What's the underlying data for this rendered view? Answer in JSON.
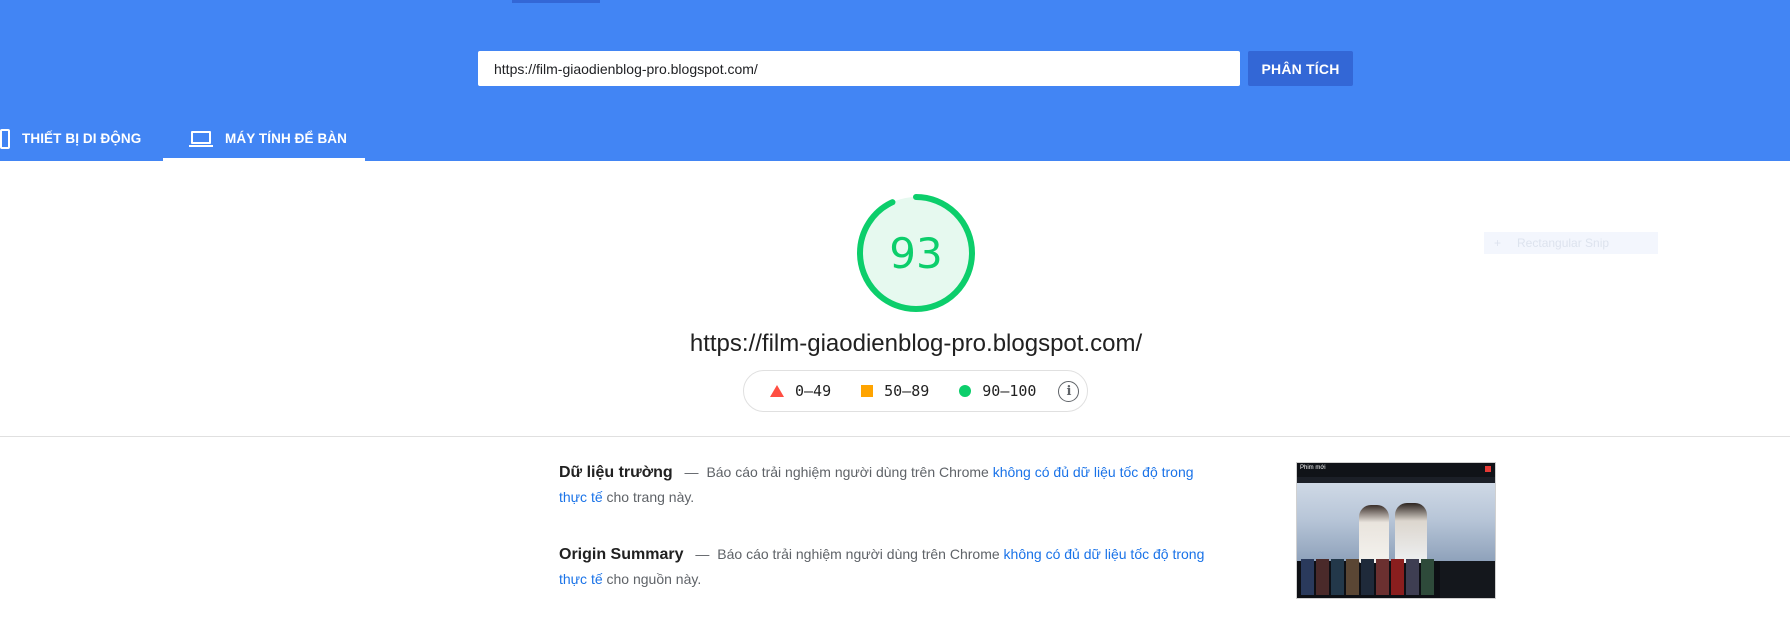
{
  "header": {
    "url_value": "https://film-giaodienblog-pro.blogspot.com/",
    "analyze_label": "PHÂN TÍCH",
    "tabs": [
      {
        "label": "THIẾT BỊ DI ĐỘNG",
        "icon": "phone-icon",
        "active": false
      },
      {
        "label": "MÁY TÍNH ĐỂ BÀN",
        "icon": "laptop-icon",
        "active": true
      }
    ],
    "colors": {
      "background": "#4285f4",
      "button": "#3367d6"
    }
  },
  "score": {
    "value": "93",
    "fraction": 0.93,
    "color": "#0cce6b",
    "analyzed_url": "https://film-giaodienblog-pro.blogspot.com/"
  },
  "legend": {
    "items": [
      {
        "range": "0–49",
        "shape": "triangle",
        "color": "#ff4e42"
      },
      {
        "range": "50–89",
        "shape": "square",
        "color": "#ffa400"
      },
      {
        "range": "90–100",
        "shape": "circle",
        "color": "#0cce6b"
      }
    ],
    "info_icon": "info-icon"
  },
  "overlay": {
    "snip_label": "Rectangular Snip"
  },
  "field_data": {
    "title": "Dữ liệu trường",
    "dash": "—",
    "text_before": "Báo cáo trải nghiệm người dùng trên Chrome ",
    "link_text": "không có đủ dữ liệu tốc độ trong thực tế",
    "text_after": " cho trang này."
  },
  "origin_summary": {
    "title": "Origin Summary",
    "dash": "—",
    "text_before": "Báo cáo trải nghiệm người dùng trên Chrome ",
    "link_text": "không có đủ dữ liệu tốc độ trong thực tế",
    "text_after": " cho nguồn này."
  },
  "thumbnail": {
    "logo_text": "Phim mới"
  }
}
